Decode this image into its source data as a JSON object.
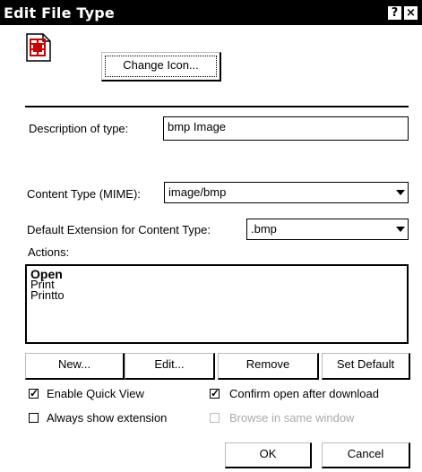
{
  "window": {
    "title": "Edit File Type",
    "help_glyph": "?",
    "close_glyph": "×"
  },
  "icon_section": {
    "file_icon": "bmp-file-icon",
    "change_icon_button": "Change Icon..."
  },
  "description": {
    "label": "Description of type:",
    "value": "bmp Image"
  },
  "content_type": {
    "label": "Content Type (MIME):",
    "value": "image/bmp"
  },
  "default_extension": {
    "label": "Default Extension for Content Type:",
    "value": ".bmp"
  },
  "actions": {
    "label": "Actions:",
    "items": [
      {
        "label": "Open",
        "default": true
      },
      {
        "label": "Print",
        "default": false
      },
      {
        "label": "Printto",
        "default": false
      }
    ]
  },
  "action_buttons": {
    "new": "New...",
    "edit": "Edit...",
    "remove": "Remove",
    "set_default": "Set Default"
  },
  "checkboxes": {
    "enable_quick_view": {
      "label": "Enable Quick View",
      "checked": true
    },
    "confirm_open": {
      "label": "Confirm open after download",
      "checked": true
    },
    "always_show_extension": {
      "label": "Always show extension",
      "checked": false
    },
    "browse_same_window": {
      "label": "Browse in same window",
      "checked": false,
      "disabled": true
    }
  },
  "dialog_buttons": {
    "ok": "OK",
    "cancel": "Cancel"
  },
  "colors": {
    "titlebar": "#000000",
    "background": "#ffffff",
    "icon_accent": "#cc0000",
    "disabled_text": "#aaaaaa"
  }
}
